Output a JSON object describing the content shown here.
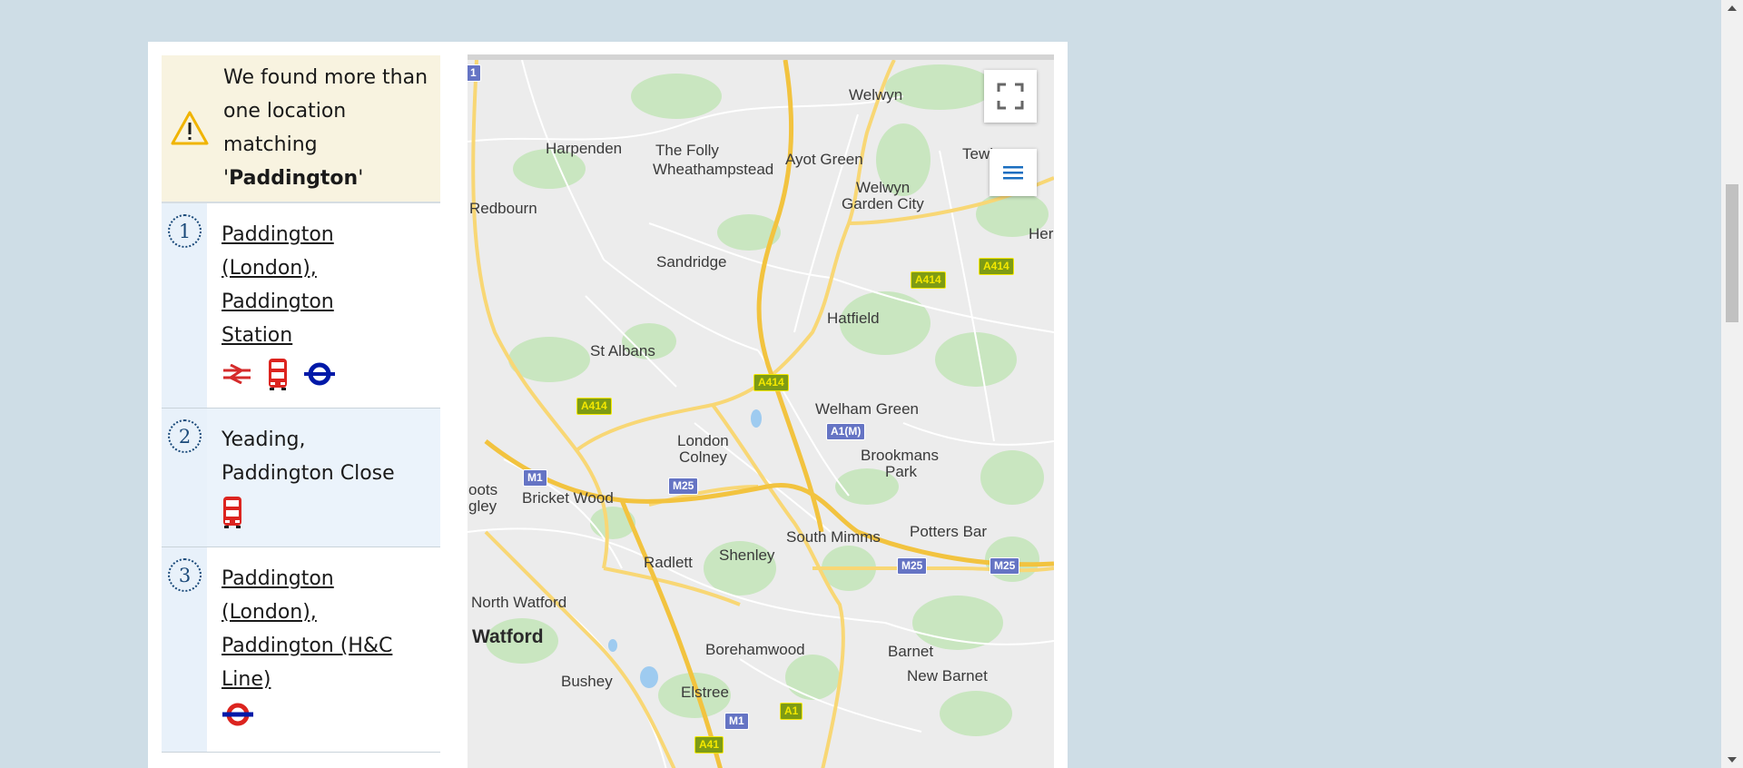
{
  "warning": {
    "line1": "We found more than",
    "line2": "one location",
    "line3": "matching",
    "quote_open": "'",
    "query": "Paddington",
    "quote_close": "'"
  },
  "results": [
    {
      "number": "1",
      "title_lines": [
        "Paddington",
        "(London),",
        "Paddington",
        "Station"
      ],
      "linked": true,
      "modes": [
        "national-rail-icon",
        "bus-icon",
        "overground-icon"
      ]
    },
    {
      "number": "2",
      "title_lines": [
        "Yeading,",
        "Paddington Close"
      ],
      "linked": false,
      "modes": [
        "bus-icon"
      ]
    },
    {
      "number": "3",
      "title_lines": [
        "Paddington",
        "(London),",
        "Paddington (H&C",
        "Line)"
      ],
      "linked": true,
      "modes": [
        "underground-icon"
      ]
    }
  ],
  "map": {
    "places": [
      {
        "id": "welwyn",
        "text": "Welwyn"
      },
      {
        "id": "harpenden",
        "text": "Harpenden"
      },
      {
        "id": "the-folly",
        "text": "The Folly"
      },
      {
        "id": "wheathampstead",
        "text": "Wheathampstead"
      },
      {
        "id": "ayot-green",
        "text": "Ayot Green"
      },
      {
        "id": "tewin",
        "text": "Tewin"
      },
      {
        "id": "welwyn-gc-1",
        "text": "Welwyn"
      },
      {
        "id": "welwyn-gc-2",
        "text": "Garden City"
      },
      {
        "id": "redbourn",
        "text": "Redbourn"
      },
      {
        "id": "her",
        "text": "Her"
      },
      {
        "id": "sandridge",
        "text": "Sandridge"
      },
      {
        "id": "hatfield",
        "text": "Hatfield"
      },
      {
        "id": "st-albans",
        "text": "St Albans"
      },
      {
        "id": "welham-green",
        "text": "Welham Green"
      },
      {
        "id": "london-colney-1",
        "text": "London"
      },
      {
        "id": "london-colney-2",
        "text": "Colney"
      },
      {
        "id": "brookmans-1",
        "text": "Brookmans"
      },
      {
        "id": "brookmans-2",
        "text": "Park"
      },
      {
        "id": "abbots-1",
        "text": "oots"
      },
      {
        "id": "abbots-2",
        "text": "gley"
      },
      {
        "id": "bricket-wood",
        "text": "Bricket Wood"
      },
      {
        "id": "potters-bar",
        "text": "Potters Bar"
      },
      {
        "id": "south-mimms",
        "text": "South Mimms"
      },
      {
        "id": "shenley",
        "text": "Shenley"
      },
      {
        "id": "radlett",
        "text": "Radlett"
      },
      {
        "id": "north-watford",
        "text": "North Watford"
      },
      {
        "id": "watford",
        "text": "Watford"
      },
      {
        "id": "borehamwood",
        "text": "Borehamwood"
      },
      {
        "id": "barnet",
        "text": "Barnet"
      },
      {
        "id": "new-barnet",
        "text": "New Barnet"
      },
      {
        "id": "bushey",
        "text": "Bushey"
      },
      {
        "id": "elstree",
        "text": "Elstree"
      }
    ],
    "shields": [
      {
        "id": "a414-1",
        "text": "A414",
        "kind": "a"
      },
      {
        "id": "a414-2",
        "text": "A414",
        "kind": "a"
      },
      {
        "id": "a414-3",
        "text": "A414",
        "kind": "a"
      },
      {
        "id": "a414-4",
        "text": "A414",
        "kind": "a"
      },
      {
        "id": "a1m",
        "text": "A1(M)",
        "kind": "m"
      },
      {
        "id": "m1-1",
        "text": "M1",
        "kind": "m"
      },
      {
        "id": "m25-1",
        "text": "M25",
        "kind": "m"
      },
      {
        "id": "m25-2",
        "text": "M25",
        "kind": "m"
      },
      {
        "id": "m25-3",
        "text": "M25",
        "kind": "m"
      },
      {
        "id": "m1-2",
        "text": "M1",
        "kind": "m"
      },
      {
        "id": "a1",
        "text": "A1",
        "kind": "a"
      },
      {
        "id": "a41",
        "text": "A41",
        "kind": "a"
      },
      {
        "id": "m1-edge",
        "text": "1",
        "kind": "m"
      }
    ],
    "controls": {
      "fullscreen": "fullscreen-icon",
      "layers": "menu-icon"
    }
  },
  "colors": {
    "background": "#cedde6",
    "warning_bg": "#f8f3e0",
    "result_bg": "#ebf3fb",
    "link_text": "#1a1a1a",
    "rail_red": "#d52b2b",
    "bus_red": "#dc241f",
    "tube_blue": "#0019a8"
  }
}
